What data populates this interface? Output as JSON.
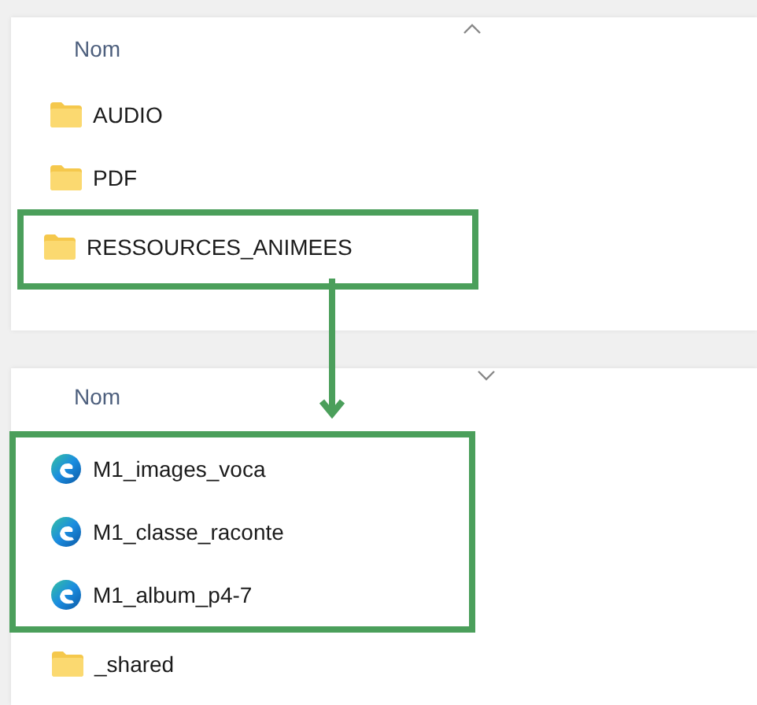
{
  "panels": [
    {
      "header": {
        "label": "Nom",
        "sorted_ascending": true
      },
      "rows": [
        {
          "name": "AUDIO",
          "kind": "folder",
          "highlighted": false
        },
        {
          "name": "PDF",
          "kind": "folder",
          "highlighted": false
        },
        {
          "name": "RESSOURCES_ANIMEES",
          "kind": "folder",
          "highlighted": true
        }
      ]
    },
    {
      "header": {
        "label": "Nom",
        "sorted_ascending": false
      },
      "rows": [
        {
          "name": "M1_images_voca",
          "kind": "web-file",
          "highlighted": true
        },
        {
          "name": "M1_classe_raconte",
          "kind": "web-file",
          "highlighted": true
        },
        {
          "name": "M1_album_p4-7",
          "kind": "web-file",
          "highlighted": true
        },
        {
          "name": "_shared",
          "kind": "folder",
          "highlighted": false
        }
      ]
    }
  ]
}
